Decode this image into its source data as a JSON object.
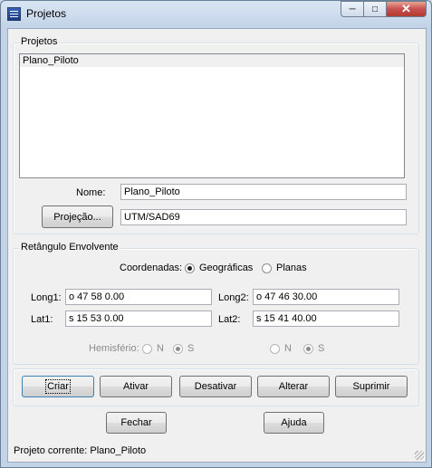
{
  "window": {
    "title": "Projetos"
  },
  "projetos": {
    "group_label": "Projetos",
    "items": [
      "Plano_Piloto"
    ],
    "nome_label": "Nome:",
    "nome_value": "Plano_Piloto",
    "projecao_button": "Projeção...",
    "projecao_value": "UTM/SAD69"
  },
  "retangulo": {
    "group_label": "Retângulo Envolvente",
    "coordenadas_label": "Coordenadas:",
    "geograficas_label": "Geográficas",
    "planas_label": "Planas",
    "coordenadas_selected": "Geográficas",
    "long1_label": "Long1:",
    "long1_value": "o 47  58  0.00",
    "long2_label": "Long2:",
    "long2_value": "o 47  46  30.00",
    "lat1_label": "Lat1:",
    "lat1_value": "s 15  53  0.00",
    "lat2_label": "Lat2:",
    "lat2_value": "s 15  41  40.00",
    "hemisferio_label": "Hemisfério:",
    "n_label": "N",
    "s_label": "S",
    "hemisferio1_selected": "S",
    "hemisferio2_selected": "S"
  },
  "actions": {
    "criar": "Criar",
    "ativar": "Ativar",
    "desativar": "Desativar",
    "alterar": "Alterar",
    "suprimir": "Suprimir"
  },
  "footer": {
    "fechar": "Fechar",
    "ajuda": "Ajuda",
    "status": "Projeto corrente: Plano_Piloto"
  }
}
